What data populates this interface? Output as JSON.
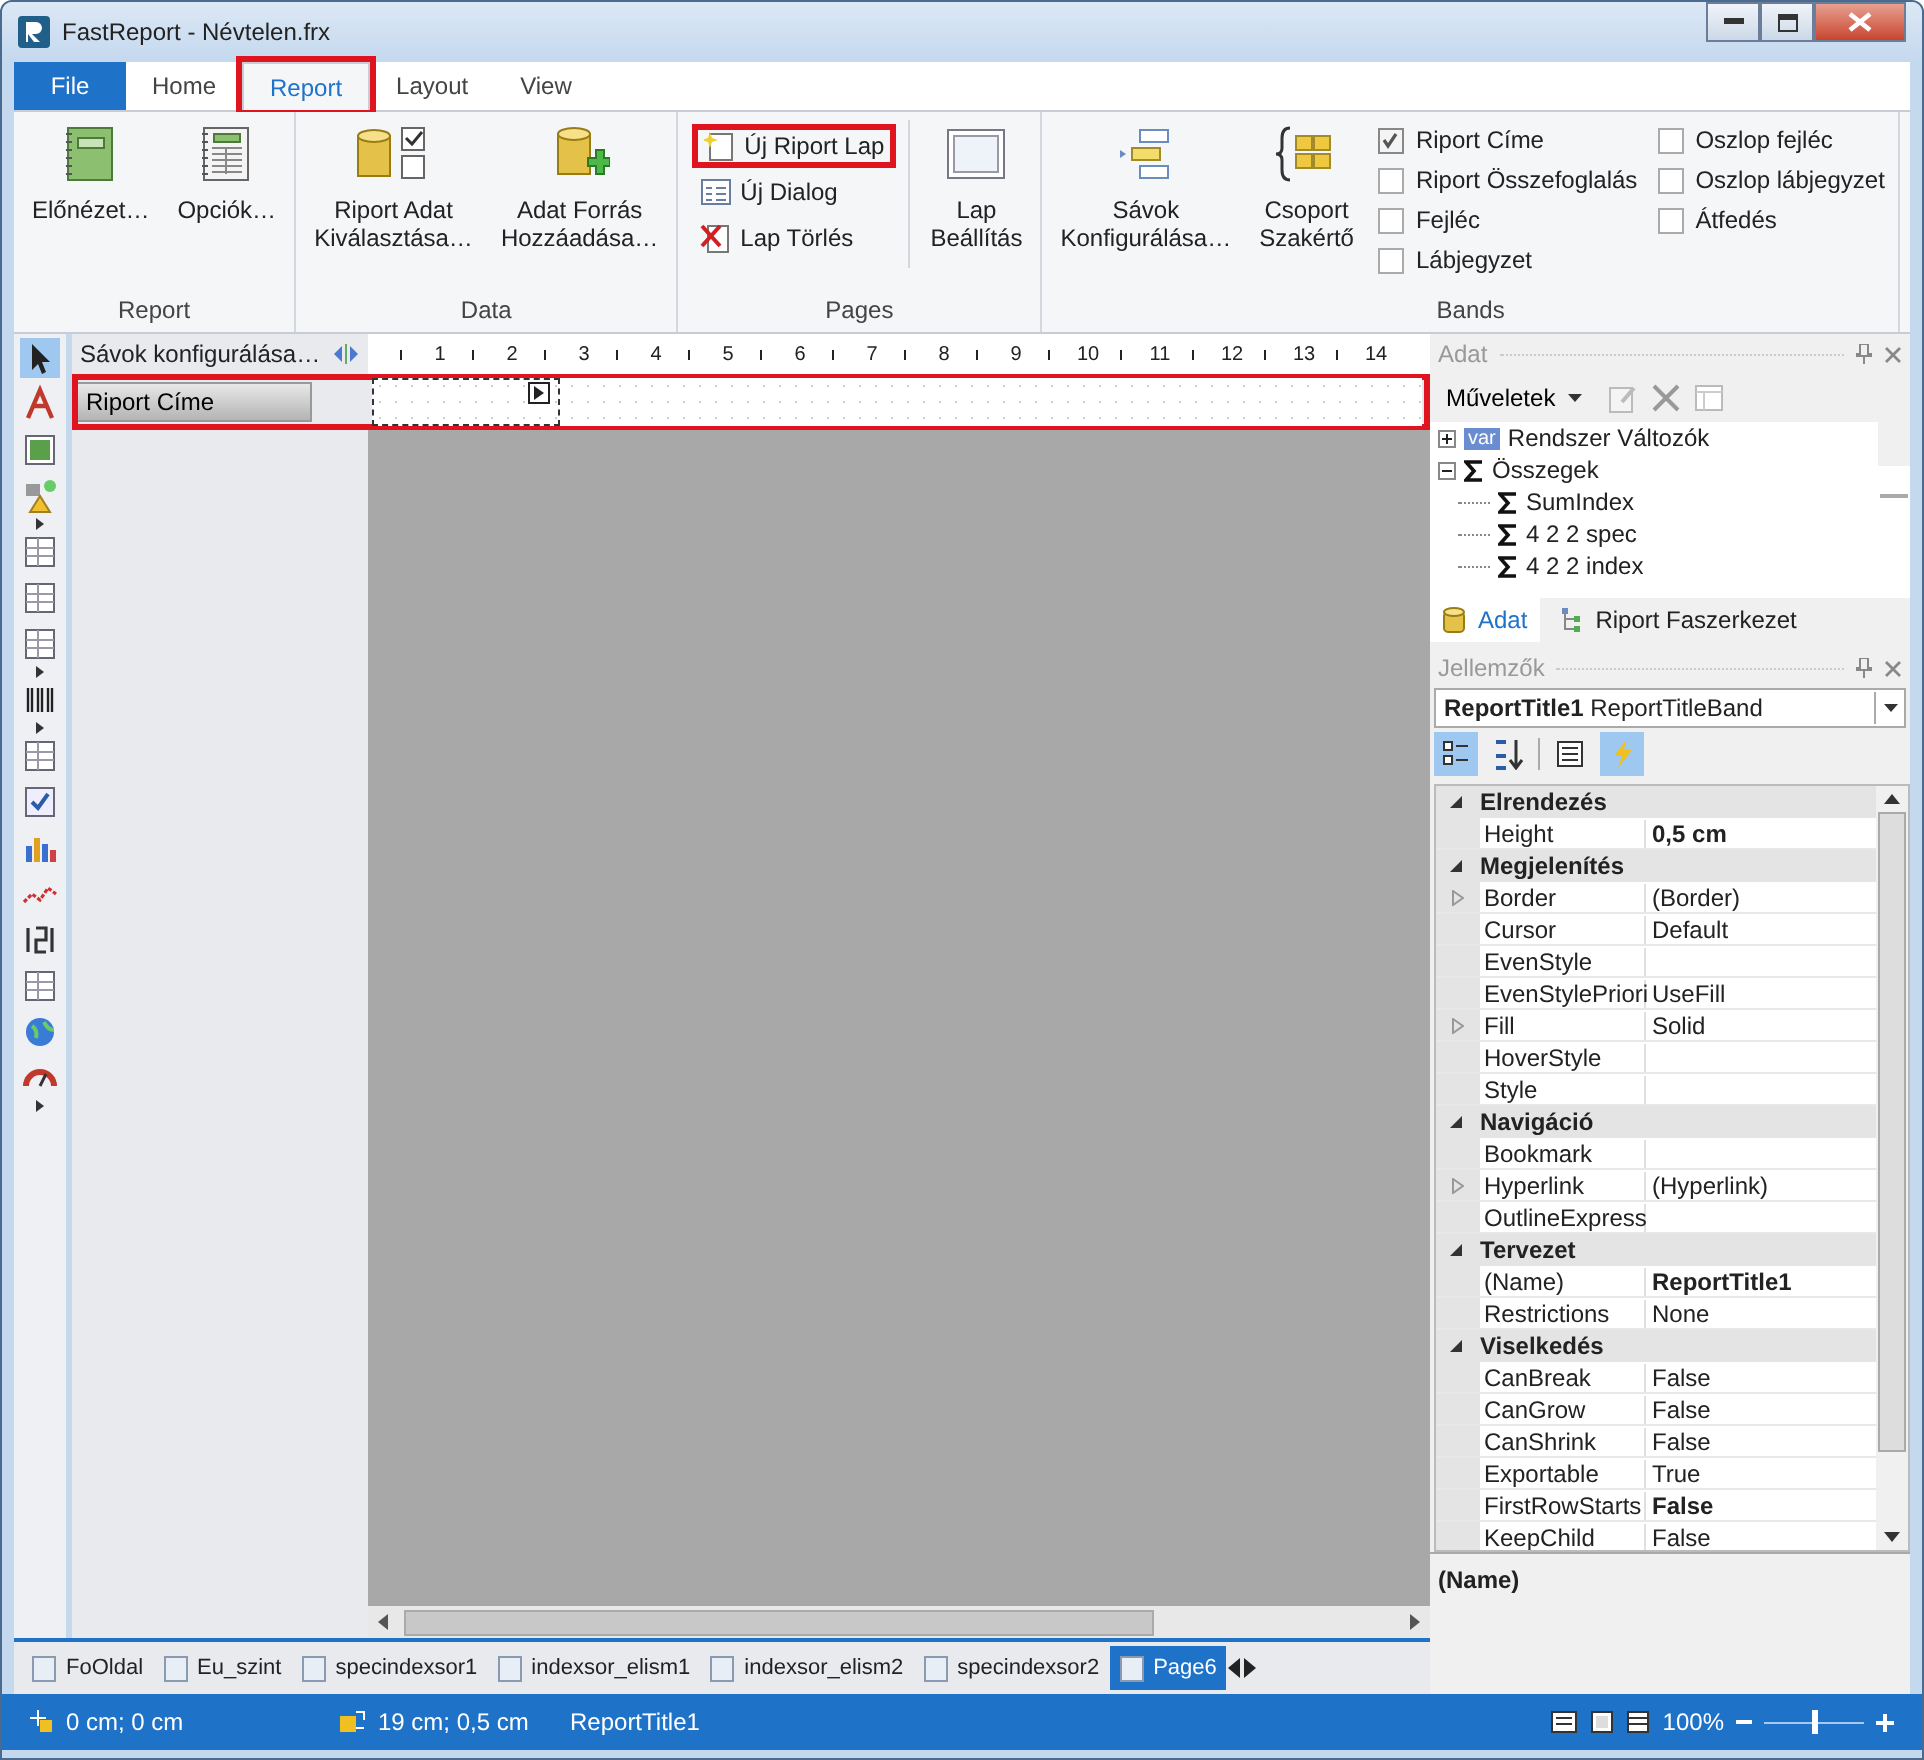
{
  "window": {
    "title": "FastReport - Névtelen.frx"
  },
  "ribbon_tabs": [
    {
      "label": "File",
      "kind": "file",
      "selected": false,
      "annotated": false
    },
    {
      "label": "Home",
      "kind": "tab",
      "selected": false,
      "annotated": false
    },
    {
      "label": "Report",
      "kind": "tab",
      "selected": true,
      "annotated": true
    },
    {
      "label": "Layout",
      "kind": "tab",
      "selected": false,
      "annotated": false
    },
    {
      "label": "View",
      "kind": "tab",
      "selected": false,
      "annotated": false
    }
  ],
  "ribbon_groups": [
    {
      "label": "Report",
      "items": [
        {
          "kind": "large",
          "lines": [
            "Előnézet…"
          ],
          "annotated": false
        },
        {
          "kind": "large",
          "lines": [
            "Opciók…"
          ],
          "annotated": false
        }
      ]
    },
    {
      "label": "Data",
      "items": [
        {
          "kind": "large",
          "lines": [
            "Riport Adat",
            "Kiválasztása…"
          ],
          "annotated": false
        },
        {
          "kind": "large",
          "lines": [
            "Adat Forrás",
            "Hozzáadása…"
          ],
          "annotated": false
        }
      ]
    },
    {
      "label": "Pages",
      "items": [
        {
          "kind": "small",
          "lines": [
            "Új Riport Lap"
          ],
          "annotated": true
        },
        {
          "kind": "small",
          "lines": [
            "Új Dialog"
          ],
          "annotated": false
        },
        {
          "kind": "small",
          "lines": [
            "Lap Törlés"
          ],
          "annotated": false
        },
        {
          "kind": "large",
          "lines": [
            "Lap",
            "Beállítás"
          ],
          "annotated": false
        }
      ]
    },
    {
      "label": "Bands",
      "items": [
        {
          "kind": "large",
          "lines": [
            "Sávok",
            "Konfigurálása…"
          ],
          "annotated": false
        },
        {
          "kind": "large",
          "lines": [
            "Csoport",
            "Szakértő"
          ],
          "annotated": false
        },
        {
          "kind": "check",
          "lines": [
            "Riport Címe"
          ],
          "checked": true
        },
        {
          "kind": "check",
          "lines": [
            "Riport Összefoglalás"
          ],
          "checked": false
        },
        {
          "kind": "check",
          "lines": [
            "Fejléc"
          ],
          "checked": false
        },
        {
          "kind": "check",
          "lines": [
            "Lábjegyzet"
          ],
          "checked": false
        },
        {
          "kind": "check",
          "lines": [
            "Oszlop fejléc"
          ],
          "checked": false
        },
        {
          "kind": "check",
          "lines": [
            "Oszlop lábjegyzet"
          ],
          "checked": false
        },
        {
          "kind": "check",
          "lines": [
            "Átfedés"
          ],
          "checked": false
        }
      ]
    }
  ],
  "designer": {
    "bands_header": "Sávok konfigurálása…",
    "ruler": [
      "1",
      "2",
      "3",
      "4",
      "5",
      "6",
      "7",
      "8",
      "9",
      "10",
      "11",
      "12",
      "13",
      "14"
    ],
    "bands": [
      {
        "label": "Riport Címe",
        "annotated": true
      }
    ]
  },
  "page_tabs": [
    {
      "label": "FoOldal",
      "selected": false
    },
    {
      "label": "Eu_szint",
      "selected": false
    },
    {
      "label": "specindexsor1",
      "selected": false
    },
    {
      "label": "indexsor_elism1",
      "selected": false
    },
    {
      "label": "indexsor_elism2",
      "selected": false
    },
    {
      "label": "specindexsor2",
      "selected": false
    },
    {
      "label": "Page6",
      "selected": true
    }
  ],
  "data_panel": {
    "title": "Adat",
    "actions": "Műveletek",
    "tree": [
      {
        "label": "Rendszer Változók",
        "kind": "var",
        "badge": "var",
        "expanded": false
      },
      {
        "label": "Összegek",
        "kind": "sum",
        "expanded": true,
        "children": [
          {
            "label": "SumIndex",
            "kind": "sum"
          },
          {
            "label": "4 2 2 spec",
            "kind": "sum"
          },
          {
            "label": "4 2 2 index",
            "kind": "sum"
          }
        ]
      }
    ],
    "tabs": [
      {
        "label": "Adat",
        "selected": true
      },
      {
        "label": "Riport Faszerkezet",
        "selected": false
      }
    ]
  },
  "properties_panel": {
    "title": "Jellemzők",
    "object_name": "ReportTitle1",
    "object_type": "ReportTitleBand",
    "tools": [
      {
        "selected": true
      },
      {
        "selected": false
      },
      {
        "selected": false
      },
      {
        "selected": true
      }
    ],
    "categories": [
      {
        "name": "Elrendezés",
        "expanded": true,
        "rows": [
          {
            "name": "Height",
            "value": "0,5 cm",
            "modified": true,
            "expandable": false
          }
        ]
      },
      {
        "name": "Megjelenítés",
        "expanded": true,
        "rows": [
          {
            "name": "Border",
            "value": "(Border)",
            "modified": false,
            "expandable": true
          },
          {
            "name": "Cursor",
            "value": "Default",
            "modified": false,
            "expandable": false
          },
          {
            "name": "EvenStyle",
            "expandable": false
          },
          {
            "name": "EvenStylePriori",
            "value": "UseFill",
            "modified": false,
            "expandable": false
          },
          {
            "name": "Fill",
            "value": "Solid",
            "modified": false,
            "expandable": true
          },
          {
            "name": "HoverStyle",
            "expandable": false
          },
          {
            "name": "Style",
            "expandable": false
          }
        ]
      },
      {
        "name": "Navigáció",
        "expanded": true,
        "rows": [
          {
            "name": "Bookmark",
            "expandable": false
          },
          {
            "name": "Hyperlink",
            "value": "(Hyperlink)",
            "modified": false,
            "expandable": true
          },
          {
            "name": "OutlineExpress",
            "expandable": false
          }
        ]
      },
      {
        "name": "Tervezet",
        "expanded": true,
        "rows": [
          {
            "name": "(Name)",
            "value": "ReportTitle1",
            "modified": true,
            "expandable": false
          },
          {
            "name": "Restrictions",
            "value": "None",
            "modified": false,
            "expandable": false
          }
        ]
      },
      {
        "name": "Viselkedés",
        "expanded": true,
        "rows": [
          {
            "name": "CanBreak",
            "value": "False",
            "modified": false,
            "expandable": false
          },
          {
            "name": "CanGrow",
            "value": "False",
            "modified": false,
            "expandable": false
          },
          {
            "name": "CanShrink",
            "value": "False",
            "modified": false,
            "expandable": false
          },
          {
            "name": "Exportable",
            "value": "True",
            "modified": false,
            "expandable": false
          },
          {
            "name": "FirstRowStarts",
            "value": "False",
            "modified": true,
            "expandable": false
          },
          {
            "name": "KeepChild",
            "value": "False",
            "modified": false,
            "expandable": false
          }
        ]
      }
    ],
    "description": "(Name)"
  },
  "status_bar": {
    "position": "0 cm; 0 cm",
    "size": "19 cm; 0,5 cm",
    "object": "ReportTitle1",
    "zoom": "100%",
    "zoom_slider": {
      "level": 0.5
    }
  }
}
